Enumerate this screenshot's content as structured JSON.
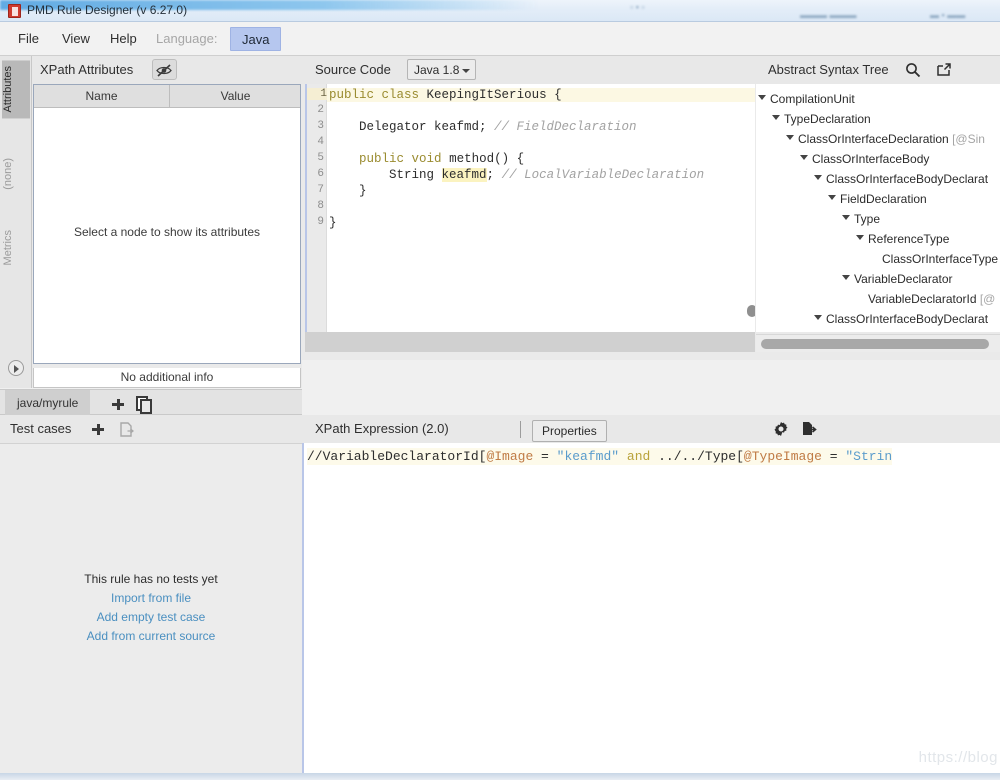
{
  "window": {
    "title": "PMD Rule Designer (v 6.27.0)",
    "app_icon": "pmd-logo-icon"
  },
  "menubar": {
    "items": [
      {
        "label": "File",
        "enabled": true
      },
      {
        "label": "View",
        "enabled": true
      },
      {
        "label": "Help",
        "enabled": true
      },
      {
        "label": "Language:",
        "enabled": false
      }
    ],
    "language_value": "Java"
  },
  "left_vertical_tabs": [
    {
      "label": "Attributes",
      "active": true
    },
    {
      "label": "(none)",
      "active": false
    },
    {
      "label": "Metrics",
      "active": false
    }
  ],
  "attributes_panel": {
    "title": "XPath Attributes",
    "hide_button_icon": "eye-slash-icon",
    "columns": [
      "Name",
      "Value"
    ],
    "rows": [],
    "empty_message": "Select a node to show its attributes",
    "footer": "No additional info"
  },
  "rule_tabs": {
    "active_tab": "java/myrule",
    "add_icon": "plus-icon",
    "duplicate_icon": "copy-icon"
  },
  "test_cases_panel": {
    "title": "Test cases",
    "add_icon": "plus-icon",
    "import_icon": "import-file-icon",
    "empty_message": "This rule has no tests yet",
    "links": [
      "Import from file",
      "Add empty test case",
      "Add from current source"
    ]
  },
  "source_panel": {
    "title": "Source Code",
    "language_version": "Java 1.8",
    "current_line": 1,
    "lines": [
      {
        "n": 1,
        "tokens": [
          {
            "t": "public",
            "c": "kw"
          },
          {
            "t": " "
          },
          {
            "t": "class",
            "c": "kw"
          },
          {
            "t": " KeepingItSerious {"
          }
        ]
      },
      {
        "n": 2,
        "tokens": []
      },
      {
        "n": 3,
        "tokens": [
          {
            "t": "    Delegator keafmd; "
          },
          {
            "t": "// FieldDeclaration",
            "c": "cm"
          }
        ]
      },
      {
        "n": 4,
        "tokens": []
      },
      {
        "n": 5,
        "tokens": [
          {
            "t": "    "
          },
          {
            "t": "public",
            "c": "kw"
          },
          {
            "t": " "
          },
          {
            "t": "void",
            "c": "kw"
          },
          {
            "t": " method() {"
          }
        ]
      },
      {
        "n": 6,
        "tokens": [
          {
            "t": "        String "
          },
          {
            "t": "keafmd",
            "c": "hl"
          },
          {
            "t": "; "
          },
          {
            "t": "// LocalVariableDeclaration",
            "c": "cm"
          }
        ]
      },
      {
        "n": 7,
        "tokens": [
          {
            "t": "    }"
          }
        ]
      },
      {
        "n": 8,
        "tokens": []
      },
      {
        "n": 9,
        "tokens": [
          {
            "t": "}"
          }
        ]
      }
    ]
  },
  "ast_panel": {
    "title": "Abstract Syntax Tree",
    "search_icon": "search-icon",
    "expand_icon": "external-link-icon",
    "nodes": [
      {
        "label": "CompilationUnit",
        "depth": 0,
        "expanded": true,
        "attr": ""
      },
      {
        "label": "TypeDeclaration",
        "depth": 1,
        "expanded": true,
        "attr": ""
      },
      {
        "label": "ClassOrInterfaceDeclaration",
        "depth": 2,
        "expanded": true,
        "attr": "[@Sin"
      },
      {
        "label": "ClassOrInterfaceBody",
        "depth": 3,
        "expanded": true,
        "attr": ""
      },
      {
        "label": "ClassOrInterfaceBodyDeclarat",
        "depth": 4,
        "expanded": true,
        "attr": ""
      },
      {
        "label": "FieldDeclaration",
        "depth": 5,
        "expanded": true,
        "attr": ""
      },
      {
        "label": "Type",
        "depth": 6,
        "expanded": true,
        "attr": ""
      },
      {
        "label": "ReferenceType",
        "depth": 7,
        "expanded": true,
        "attr": ""
      },
      {
        "label": "ClassOrInterfaceType",
        "depth": 8,
        "expanded": false,
        "attr": ""
      },
      {
        "label": "VariableDeclarator",
        "depth": 6,
        "expanded": true,
        "attr": ""
      },
      {
        "label": "VariableDeclaratorId",
        "depth": 7,
        "expanded": false,
        "attr": "[@"
      },
      {
        "label": "ClassOrInterfaceBodyDeclarat",
        "depth": 4,
        "expanded": true,
        "attr": ""
      }
    ]
  },
  "xpath_panel": {
    "title": "XPath Expression (2.0)",
    "settings_icon": "gear-icon",
    "export_icon": "export-icon",
    "properties_label": "Properties",
    "expression_tokens": [
      {
        "t": "//VariableDeclaratorId["
      },
      {
        "t": "@Image",
        "c": "x-at"
      },
      {
        "t": " = "
      },
      {
        "t": "\"keafmd\"",
        "c": "x-str"
      },
      {
        "t": " "
      },
      {
        "t": "and",
        "c": "x-and"
      },
      {
        "t": " ../../Type["
      },
      {
        "t": "@TypeImage",
        "c": "x-at"
      },
      {
        "t": " = "
      },
      {
        "t": "\"Strin",
        "c": "x-str"
      }
    ]
  },
  "watermark": "https://blog"
}
